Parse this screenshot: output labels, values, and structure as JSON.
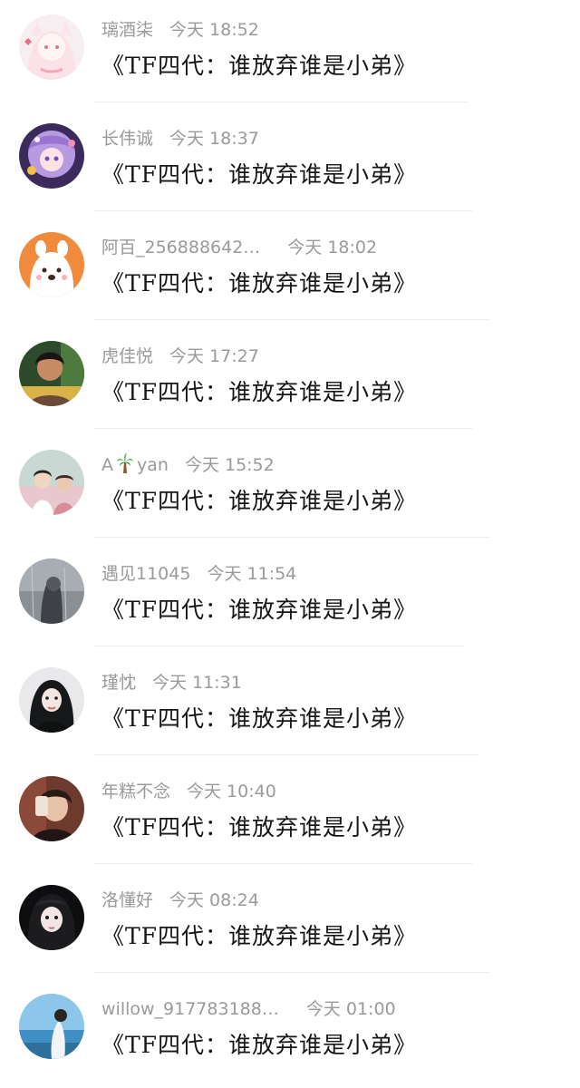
{
  "feed": {
    "items": [
      {
        "name": "璃酒柒",
        "time": "今天 18:52",
        "content": "《TF四代：谁放弃谁是小弟》"
      },
      {
        "name": "长伟诚",
        "time": "今天 18:37",
        "content": "《TF四代：谁放弃谁是小弟》"
      },
      {
        "name": "阿百_256888642…",
        "time": "今天 18:02",
        "content": "《TF四代：谁放弃谁是小弟》"
      },
      {
        "name": "虎佳悦",
        "time": "今天 17:27",
        "content": "《TF四代：谁放弃谁是小弟》"
      },
      {
        "name_prefix": "A",
        "name_suffix": "yan",
        "time": "今天 15:52",
        "content": "《TF四代：谁放弃谁是小弟》"
      },
      {
        "name": "遇见11045",
        "time": "今天 11:54",
        "content": "《TF四代：谁放弃谁是小弟》"
      },
      {
        "name": "瑾忱",
        "time": "今天 11:31",
        "content": "《TF四代：谁放弃谁是小弟》"
      },
      {
        "name": "年糕不念",
        "time": "今天 10:40",
        "content": "《TF四代：谁放弃谁是小弟》"
      },
      {
        "name": "洛懂好",
        "time": "今天 08:24",
        "content": "《TF四代：谁放弃谁是小弟》"
      },
      {
        "name": "willow_917783188…",
        "time": "今天 01:00",
        "content": "《TF四代：谁放弃谁是小弟》"
      }
    ]
  },
  "icons": {
    "palm": "palm-tree-icon"
  },
  "colors": {
    "meta_text": "#9a9a9a",
    "content_text": "#161616",
    "divider": "#ededed",
    "background": "#ffffff"
  }
}
